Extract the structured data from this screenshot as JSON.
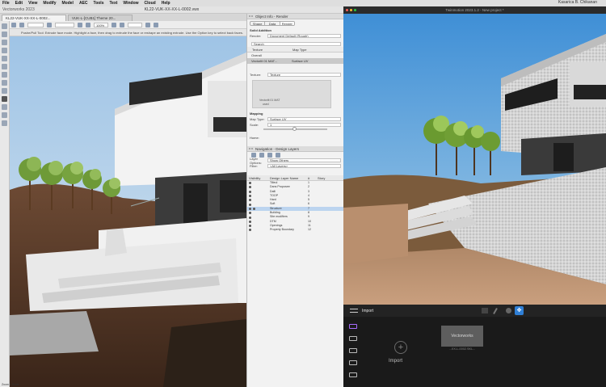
{
  "menubar": {
    "items": [
      "File",
      "Edit",
      "View",
      "Modify",
      "Model",
      "AEC",
      "Tools",
      "Text",
      "Window",
      "Cloud",
      "Help"
    ],
    "user": "Kasarica B. Chikanan"
  },
  "vectorworks": {
    "app_label": "Vectorworks 2023",
    "doc_title": "KL22-VUK-XX-XX-L-0002.vwx",
    "tabs": [
      "KL22-VUK-XX-XX-L-0002...",
      "VUK-L-[CUB1] Theme 20..."
    ],
    "zoom": "100%",
    "mode_hint": "Pushe/Pull Tool: Extrude face mode. Highlight a face, then drag to extrude the face or reshape an existing extrude. Use the Option key to select back faces.",
    "status": "Zoom 1 Scale"
  },
  "object_info": {
    "title": "Object Info - Render",
    "tabs": [
      "Shape",
      "Data",
      "Render"
    ],
    "active_tab": "Render",
    "object_type": "Solid Addition",
    "rows": {
      "render_label": "Render:",
      "render_value": "Document Default (Rough)"
    },
    "search_placeholder": "Search",
    "texture_headers": [
      "Texture",
      "Map Type"
    ],
    "overall_label": "Overall",
    "texture_row": {
      "name": "Vectorlit 01 MAT...",
      "map": "Surface UV"
    },
    "texture_label": "Texture:",
    "texture_value": "Texture",
    "preview_caption": "Vectorlit 01 MAT",
    "preview_size": "used",
    "mapping_label": "Mapping",
    "map_type_label": "Map Type:",
    "map_type_value": "Surface UV",
    "scale_label": "Scale:",
    "scale_value": "1",
    "home_label": "Home:"
  },
  "navigation": {
    "title": "Navigation - Design Layers",
    "layer_options_label": "Layer Options:",
    "layer_options_value": "Show Others",
    "filter_label": "Filter:",
    "filter_value": "<All Layers>",
    "headers": [
      "Visibility",
      "Design Layer Name",
      "#",
      "Story"
    ],
    "layers": [
      {
        "name": "Tilleul",
        "num": "1"
      },
      {
        "name": "Dans Proposee",
        "num": "2"
      },
      {
        "name": "Dalli",
        "num": "3"
      },
      {
        "name": "TOOP",
        "num": "4"
      },
      {
        "name": "Hard",
        "num": "5"
      },
      {
        "name": "Soft",
        "num": "6"
      },
      {
        "name": "Structure",
        "num": "7"
      },
      {
        "name": "Building",
        "num": "8"
      },
      {
        "name": "Site modifiers",
        "num": "9"
      },
      {
        "name": "DTM",
        "num": "10"
      },
      {
        "name": "Openings",
        "num": "11"
      },
      {
        "name": "Property Boundary",
        "num": "12"
      }
    ],
    "selected_index": 6
  },
  "twinmotion": {
    "title": "Twinmotion 2023.1.2 - New project *",
    "bar_label": "Import",
    "import_label": "Import",
    "thumb_text": "Vectorworks",
    "thumb_caption": "...XX-L-0002.SKL..."
  },
  "colors": {
    "accent": "#3b7fe0",
    "tm_accent": "#a86cff",
    "selection": "#bcd4ef"
  }
}
